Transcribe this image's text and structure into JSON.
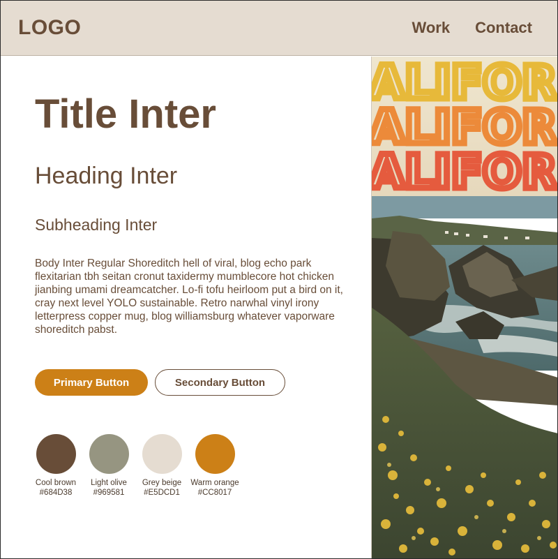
{
  "header": {
    "logo": "LOGO",
    "nav": [
      {
        "label": "Work"
      },
      {
        "label": "Contact"
      }
    ]
  },
  "main": {
    "title": "Title Inter",
    "heading": "Heading Inter",
    "subheading": "Subheading Inter",
    "body": "Body Inter Regular Shoreditch hell of viral, blog echo park flexitarian tbh seitan cronut taxidermy mumblecore hot chicken jianbing umami dreamcatcher. Lo-fi tofu heirloom put a bird on it, cray next level YOLO sustainable. Retro narwhal vinyl irony letterpress copper mug, blog williamsburg whatever vaporware shoreditch pabst.",
    "buttons": {
      "primary_label": "Primary Button",
      "secondary_label": "Secondary Button"
    },
    "swatches": [
      {
        "name": "Cool brown",
        "hex": "#684D38",
        "color": "#684D38"
      },
      {
        "name": "Light olive",
        "hex": "#969581",
        "color": "#969581"
      },
      {
        "name": "Grey beige",
        "hex": "#E5DCD1",
        "color": "#E5DCD1"
      },
      {
        "name": "Warm orange",
        "hex": "#CC8017",
        "color": "#CC8017"
      }
    ]
  },
  "photo": {
    "poster_text": "ALIFOR"
  },
  "colors": {
    "brown": "#684D38",
    "olive": "#969581",
    "beige": "#E5DCD1",
    "orange": "#CC8017"
  }
}
